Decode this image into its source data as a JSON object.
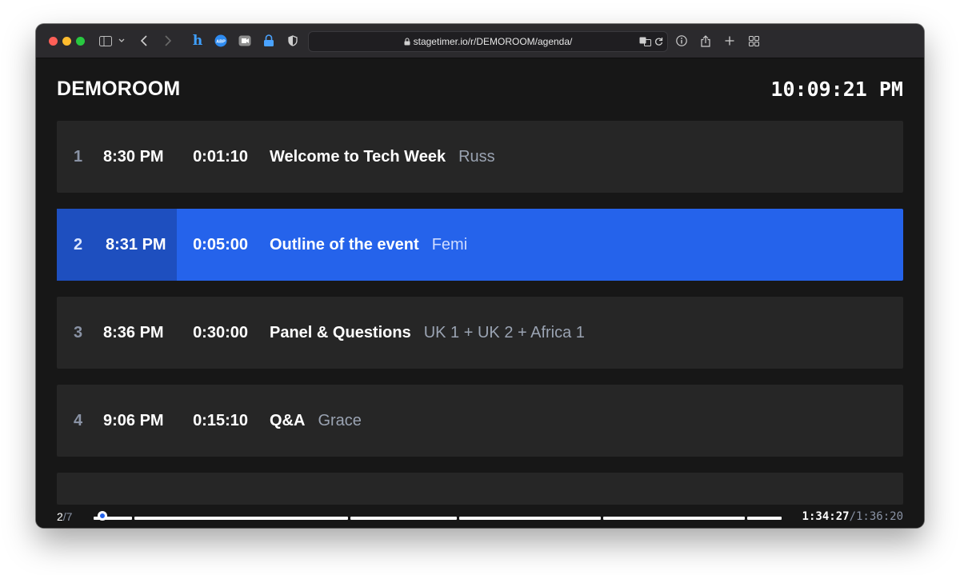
{
  "browser": {
    "url": "stagetimer.io/r/DEMOROOM/agenda/"
  },
  "page": {
    "room_name": "DEMOROOM",
    "clock": "10:09:21 PM"
  },
  "agenda": [
    {
      "num": "1",
      "start": "8:30 PM",
      "duration": "0:01:10",
      "title": "Welcome to Tech Week",
      "speaker": "Russ",
      "active": false
    },
    {
      "num": "2",
      "start": "8:31 PM",
      "duration": "0:05:00",
      "title": "Outline of the event",
      "speaker": "Femi",
      "active": true
    },
    {
      "num": "3",
      "start": "8:36 PM",
      "duration": "0:30:00",
      "title": "Panel & Questions",
      "speaker": "UK 1 + UK 2 + Africa 1",
      "active": false
    },
    {
      "num": "4",
      "start": "9:06 PM",
      "duration": "0:15:10",
      "title": "Q&A",
      "speaker": "Grace",
      "active": false
    }
  ],
  "footer": {
    "current": "2",
    "total": "/7",
    "elapsed": "1:34:27",
    "total_time": "/1:36:20",
    "progress_fraction": 0.015
  },
  "colors": {
    "accent": "#2563eb",
    "accent_dark": "#1e4fbf",
    "row_bg": "#262626",
    "page_bg": "#171717"
  }
}
